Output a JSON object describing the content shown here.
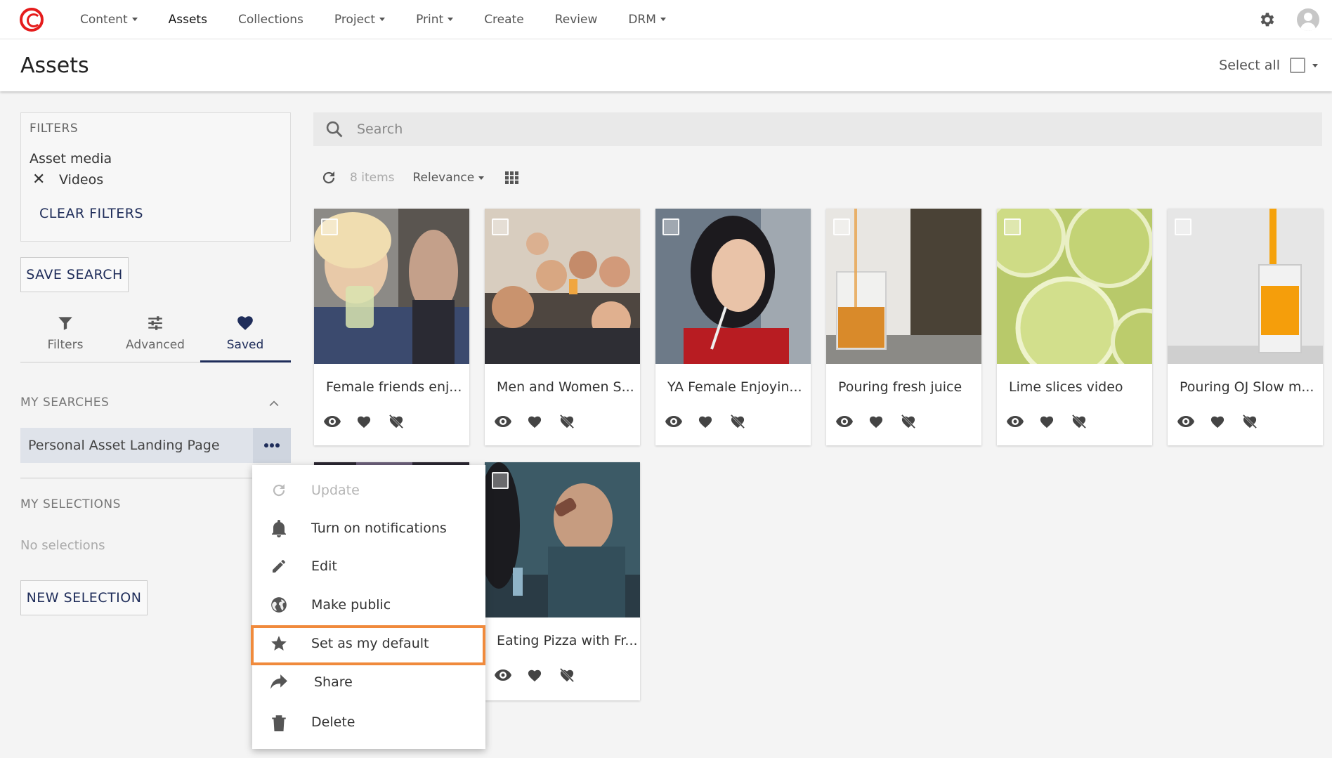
{
  "nav": {
    "items": [
      {
        "label": "Content",
        "dropdown": true,
        "active": false
      },
      {
        "label": "Assets",
        "dropdown": false,
        "active": true
      },
      {
        "label": "Collections",
        "dropdown": false,
        "active": false
      },
      {
        "label": "Project",
        "dropdown": true,
        "active": false
      },
      {
        "label": "Print",
        "dropdown": true,
        "active": false
      },
      {
        "label": "Create",
        "dropdown": false,
        "active": false
      },
      {
        "label": "Review",
        "dropdown": false,
        "active": false
      },
      {
        "label": "DRM",
        "dropdown": true,
        "active": false
      }
    ],
    "brand_color": "#e51c1c"
  },
  "header": {
    "title": "Assets",
    "select_all_label": "Select all"
  },
  "sidebar": {
    "filters_heading": "FILTERS",
    "filter_group": "Asset media",
    "active_filter": "Videos",
    "clear_filters": "CLEAR FILTERS",
    "save_search": "SAVE SEARCH",
    "tabs": [
      {
        "label": "Filters",
        "icon": "funnel-icon",
        "active": false
      },
      {
        "label": "Advanced",
        "icon": "sliders-icon",
        "active": false
      },
      {
        "label": "Saved",
        "icon": "heart-icon",
        "active": true
      }
    ],
    "my_searches_heading": "MY SEARCHES",
    "saved_search": "Personal Asset Landing Page",
    "my_selections_heading": "MY SELECTIONS",
    "no_selections": "No selections",
    "new_selection": "NEW SELECTION",
    "accent": "#1f2d5a"
  },
  "main": {
    "search_placeholder": "Search",
    "items_count": "8 items",
    "sort_label": "Relevance",
    "assets": [
      {
        "title": "Female friends enj...",
        "thumb": "women-drinking"
      },
      {
        "title": "Men and Women S...",
        "thumb": "group-selfie"
      },
      {
        "title": "YA Female Enjoyin...",
        "thumb": "woman-straw"
      },
      {
        "title": "Pouring fresh juice",
        "thumb": "juice-glass"
      },
      {
        "title": "Lime slices video",
        "thumb": "lime-slices"
      },
      {
        "title": "Pouring OJ Slow m...",
        "thumb": "orange-juice"
      },
      {
        "title": "",
        "thumb": "dark-scene"
      },
      {
        "title": "Eating Pizza with Fr...",
        "thumb": "man-drinking"
      }
    ]
  },
  "context_menu": {
    "items": [
      {
        "label": "Update",
        "icon": "refresh-icon",
        "disabled": true
      },
      {
        "label": "Turn on notifications",
        "icon": "bell-icon",
        "disabled": false
      },
      {
        "label": "Edit",
        "icon": "pencil-icon",
        "disabled": false
      },
      {
        "label": "Make public",
        "icon": "globe-icon",
        "disabled": false
      },
      {
        "label": "Set as my default",
        "icon": "star-icon",
        "disabled": false,
        "highlighted": true
      },
      {
        "label": "Share",
        "icon": "share-icon",
        "disabled": false
      },
      {
        "label": "Delete",
        "icon": "trash-icon",
        "disabled": false
      }
    ],
    "highlight_color": "#f08a3c"
  }
}
